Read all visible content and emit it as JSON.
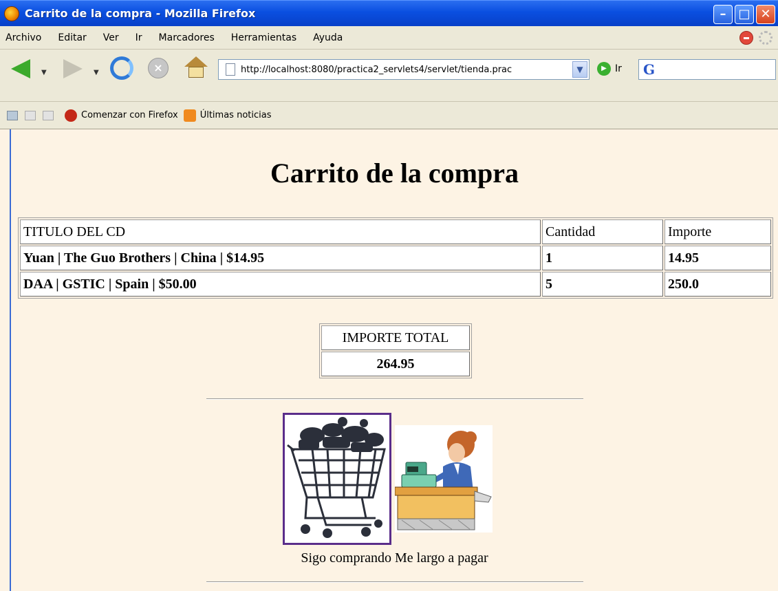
{
  "window": {
    "title": "Carrito de la compra - Mozilla Firefox",
    "minimize": "–",
    "maximize": "□",
    "close": "✕"
  },
  "menu": [
    "Archivo",
    "Editar",
    "Ver",
    "Ir",
    "Marcadores",
    "Herramientas",
    "Ayuda"
  ],
  "nav": {
    "url": "http://localhost:8080/practica2_servlets4/servlet/tienda.prac",
    "go_label": "Ir",
    "search_value": ""
  },
  "bookmarks": {
    "item1": "Comenzar con Firefox",
    "item2": "Últimas noticias"
  },
  "page": {
    "title": "Carrito de la compra",
    "table": {
      "headers": [
        "TITULO DEL CD",
        "Cantidad",
        "Importe"
      ],
      "rows": [
        [
          "Yuan | The Guo Brothers | China | $14.95",
          "1",
          "14.95"
        ],
        [
          "DAA | GSTIC | Spain | $50.00",
          "5",
          "250.0"
        ]
      ]
    },
    "total": {
      "label": "IMPORTE TOTAL",
      "value": "264.95"
    },
    "links": {
      "continue": "Sigo comprando",
      "pay": "Me largo a pagar"
    }
  }
}
